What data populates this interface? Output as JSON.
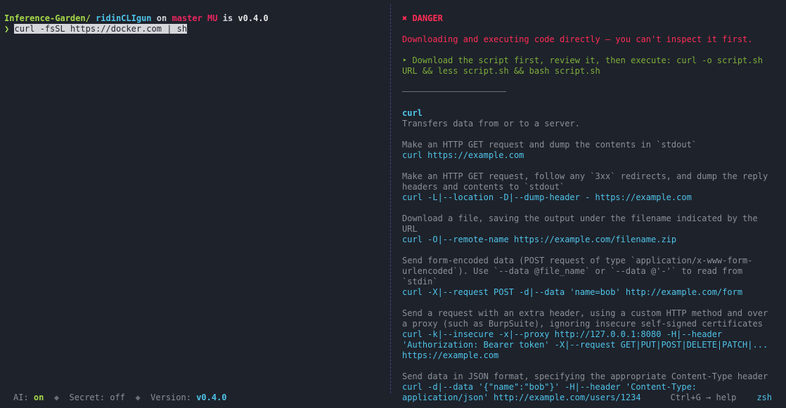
{
  "prompt": {
    "cwd": "Inference-Garden/",
    "project": "ridinCLIgun",
    "on_word": "on",
    "branch": "master MU",
    "is_word": "is",
    "version": "v0.4.0",
    "chevron": "❯",
    "command": "curl -fsSL https://docker.com | sh"
  },
  "panel": {
    "danger_label": "✖ DANGER",
    "danger_message": "Downloading and executing code directly — you can't inspect it first.",
    "suggestion": "‣ Download the script first, review it, then execute: curl -o script.sh URL && less script.sh && bash script.sh",
    "tool_name": "curl",
    "tool_description": "Transfers data from or to a server.",
    "examples": [
      {
        "description": "Make an HTTP GET request and dump the contents in `stdout`",
        "command": "curl https://example.com"
      },
      {
        "description": "Make an HTTP GET request, follow any `3xx` redirects, and dump the reply headers and contents to `stdout`",
        "command": "curl -L|--location -D|--dump-header - https://example.com"
      },
      {
        "description": "Download a file, saving the output under the filename indicated by the URL",
        "command": "curl -O|--remote-name https://example.com/filename.zip"
      },
      {
        "description": "Send form-encoded data (POST request of type `application/x-www-form-urlencoded`). Use `--data @file_name` or `--data @'-'` to read from `stdin`",
        "command": "curl -X|--request POST -d|--data 'name=bob' http://example.com/form"
      },
      {
        "description": "Send a request with an extra header, using a custom HTTP method and over a proxy (such as BurpSuite), ignoring insecure self-signed certificates",
        "command": "curl -k|--insecure -x|--proxy http://127.0.0.1:8080 -H|--header 'Authorization: Bearer token' -X|--request GET|PUT|POST|DELETE|PATCH|... https://example.com"
      },
      {
        "description": "Send data in JSON format, specifying the appropriate Content-Type header",
        "command": "curl -d|--data '{\"name\":\"bob\"}' -H|--header 'Content-Type: application/json' http://example.com/users/1234"
      }
    ]
  },
  "status": {
    "ai_label": "AI:",
    "ai_value": "on",
    "separator": "◆",
    "secret_label": "Secret:",
    "secret_value": "off",
    "version_label": "Version:",
    "version_value": "v0.4.0",
    "help_hint": "Ctrl+G → help",
    "shell": "zsh"
  },
  "colors": {
    "background": "#1e222b",
    "accent_cyan": "#4fc3e8",
    "accent_green": "#a6d84a",
    "danger_red": "#ff2d55",
    "divider_purple": "#4a3f86"
  }
}
